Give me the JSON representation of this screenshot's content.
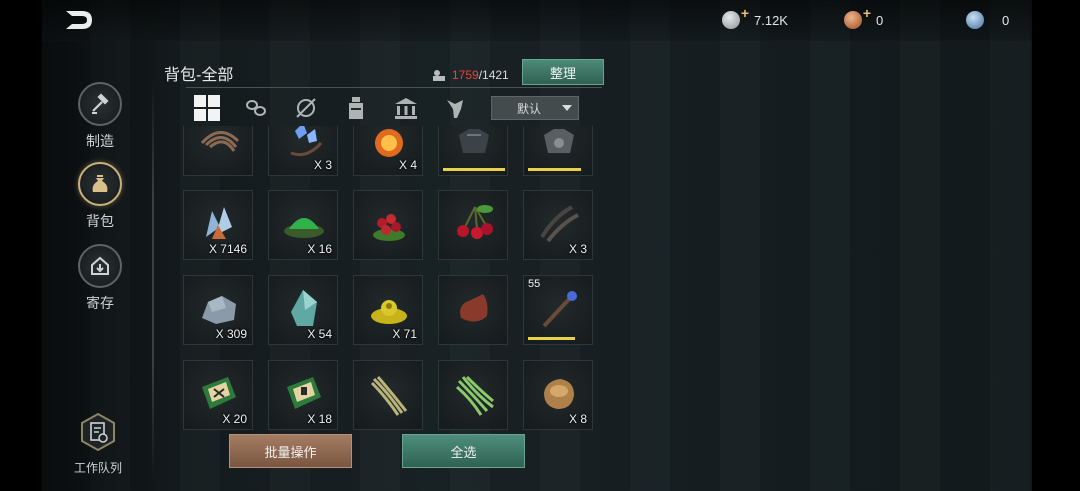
{
  "currency": [
    {
      "icon": "silver-coin-icon",
      "value": "7.12K",
      "color": "#b8bcc0"
    },
    {
      "icon": "copper-coin-icon",
      "value": "0",
      "color": "#c87a44"
    },
    {
      "icon": "blue-gem-icon",
      "value": "0",
      "color": "#6a9ad0"
    }
  ],
  "sidebar": {
    "items": [
      {
        "label": "制造",
        "icon": "hammer-icon"
      },
      {
        "label": "背包",
        "icon": "bag-icon",
        "active": true
      },
      {
        "label": "寄存",
        "icon": "storage-icon"
      }
    ],
    "queue_label": "工作队列"
  },
  "inventory": {
    "title": "背包-全部",
    "capacity_used": "1759",
    "capacity_max": "/1421",
    "sort_label": "整理",
    "sort_select": "默认",
    "tabs": [
      "all-grid-icon",
      "wood-icon",
      "plant-icon",
      "potion-icon",
      "building-icon",
      "creature-icon"
    ]
  },
  "items": [
    {
      "icon": "feather-icon",
      "qty": ""
    },
    {
      "icon": "blue-crystal-bow-icon",
      "qty": "X 3"
    },
    {
      "icon": "fire-orb-icon",
      "qty": "X 4"
    },
    {
      "icon": "dark-armor-icon",
      "qty": "",
      "durability": 1.0
    },
    {
      "icon": "metal-armor-icon",
      "qty": "",
      "durability": 0.85
    },
    {
      "icon": "crystal-shard-icon",
      "qty": "X 7146"
    },
    {
      "icon": "green-powder-icon",
      "qty": "X 16"
    },
    {
      "icon": "red-berries-icon",
      "qty": ""
    },
    {
      "icon": "cherry-icon",
      "qty": ""
    },
    {
      "icon": "dark-feathers-icon",
      "qty": "X 3"
    },
    {
      "icon": "stone-icon",
      "qty": "X 309"
    },
    {
      "icon": "teal-crystal-icon",
      "qty": "X 54"
    },
    {
      "icon": "yellow-flower-icon",
      "qty": "X 71"
    },
    {
      "icon": "leather-pouch-icon",
      "qty": ""
    },
    {
      "icon": "magic-staff-icon",
      "qty": "",
      "level": "55",
      "durability": 0.75
    },
    {
      "icon": "green-book-icon",
      "qty": "X 20"
    },
    {
      "icon": "green-book-icon",
      "qty": "X 18"
    },
    {
      "icon": "fiber-bundle-icon",
      "qty": ""
    },
    {
      "icon": "grass-bundle-icon",
      "qty": ""
    },
    {
      "icon": "seed-bag-icon",
      "qty": "X 8"
    }
  ],
  "actions": {
    "batch_label": "批量操作",
    "select_all_label": "全选"
  }
}
